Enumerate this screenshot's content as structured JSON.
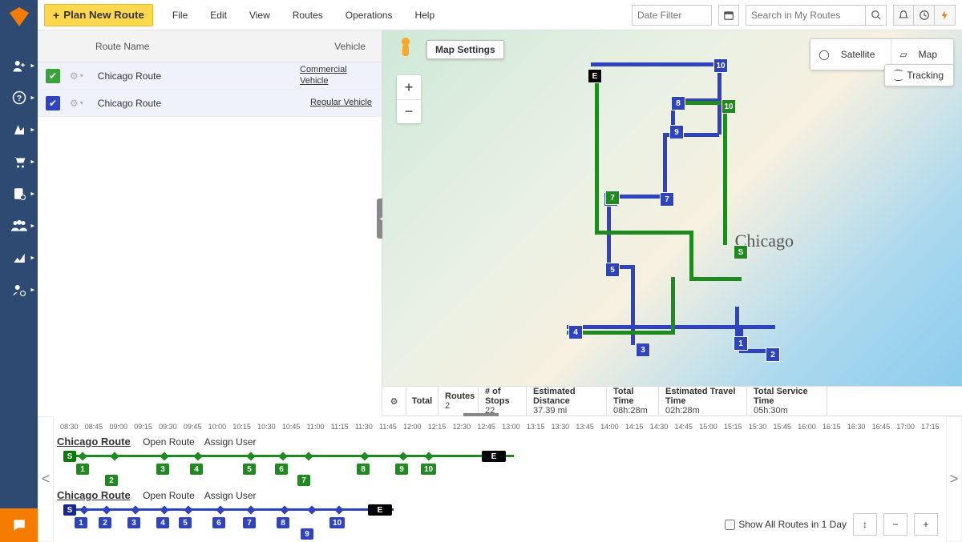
{
  "topbar": {
    "plan_button": "Plan New Route",
    "menu": [
      "File",
      "Edit",
      "View",
      "Routes",
      "Operations",
      "Help"
    ],
    "date_filter_placeholder": "Date Filter",
    "search_placeholder": "Search in My Routes"
  },
  "routes_pane": {
    "columns": {
      "name": "Route Name",
      "vehicle": "Vehicle"
    },
    "rows": [
      {
        "color": "green",
        "name": "Chicago Route",
        "vehicle": "Commercial Vehicle"
      },
      {
        "color": "blue",
        "name": "Chicago Route",
        "vehicle": "Regular Vehicle"
      }
    ]
  },
  "map": {
    "settings": "Map Settings",
    "satellite": "Satellite",
    "map": "Map",
    "tracking": "Tracking",
    "city": "Chicago"
  },
  "totals": {
    "label": "Total",
    "cells": [
      {
        "h": "Routes",
        "v": "2"
      },
      {
        "h": "# of Stops",
        "v": "22"
      },
      {
        "h": "Estimated Distance",
        "v": "37.39 mi"
      },
      {
        "h": "Total Time",
        "v": "08h:28m"
      },
      {
        "h": "Estimated Travel Time",
        "v": "02h:28m"
      },
      {
        "h": "Total Service Time",
        "v": "05h:30m"
      }
    ]
  },
  "timeline": {
    "ruler": [
      "08:30",
      "08:45",
      "09:00",
      "09:15",
      "09:30",
      "09:45",
      "10:00",
      "10:15",
      "10:30",
      "10:45",
      "11:00",
      "11:15",
      "11:30",
      "11:45",
      "12:00",
      "12:15",
      "12:30",
      "12:45",
      "13:00",
      "13:15",
      "13:30",
      "13:45",
      "14:00",
      "14:15",
      "14:30",
      "14:45",
      "15:00",
      "15:15",
      "15:30",
      "15:45",
      "16:00",
      "16:15",
      "16:30",
      "16:45",
      "17:00",
      "17:15"
    ],
    "open_route": "Open Route",
    "assign_user": "Assign User",
    "show_all": "Show All Routes in 1 Day",
    "routes": [
      {
        "name": "Chicago Route",
        "color": "#1f8a1f"
      },
      {
        "name": "Chicago Route",
        "color": "#2f43bf"
      }
    ]
  }
}
